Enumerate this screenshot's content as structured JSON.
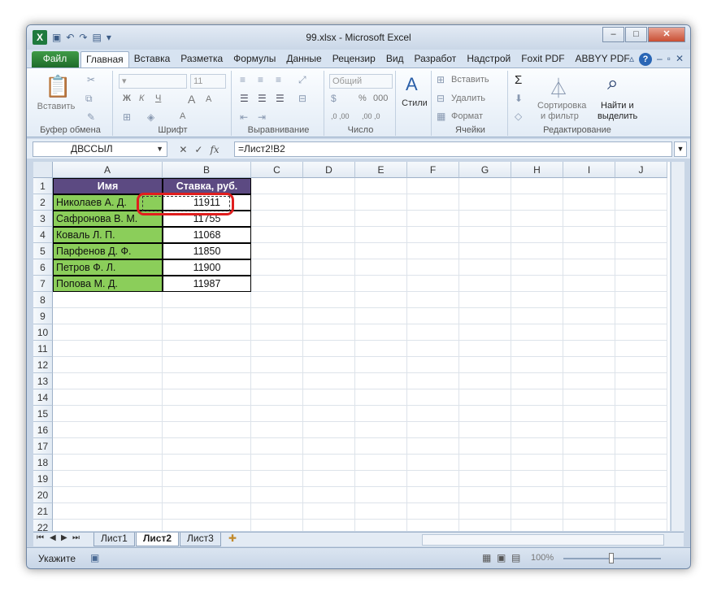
{
  "window": {
    "title": "99.xlsx - Microsoft Excel",
    "app_icon": "X"
  },
  "ribbon_tabs": [
    "Файл",
    "Главная",
    "Вставка",
    "Разметка",
    "Формулы",
    "Данные",
    "Рецензир",
    "Вид",
    "Разработ",
    "Надстрой",
    "Foxit PDF",
    "ABBYY PDF"
  ],
  "ribbon": {
    "clipboard": {
      "paste": "Вставить",
      "label": "Буфер обмена"
    },
    "font": {
      "size": "11",
      "bold": "Ж",
      "italic": "К",
      "underline": "Ч",
      "grow": "А",
      "shrink": "А",
      "label": "Шрифт"
    },
    "alignment": {
      "label": "Выравнивание"
    },
    "number": {
      "format": "Общий",
      "pct": "%",
      "comma": "000",
      "dec_inc": ",0 ,00",
      "dec_dec": ",00 ,0",
      "label": "Число"
    },
    "styles": {
      "label": "Стили"
    },
    "cells": {
      "insert": "Вставить",
      "delete": "Удалить",
      "format": "Формат",
      "label": "Ячейки"
    },
    "editing": {
      "sum": "Σ",
      "sort_line1": "Сортировка",
      "sort_line2": "и фильтр",
      "find_line1": "Найти и",
      "find_line2": "выделить",
      "label": "Редактирование"
    }
  },
  "formula_bar": {
    "name_box": "ДВССЫЛ",
    "cancel": "✕",
    "enter": "✓",
    "fx": "fx",
    "formula": "=Лист2!B2"
  },
  "columns": [
    "A",
    "B",
    "C",
    "D",
    "E",
    "F",
    "G",
    "H",
    "I",
    "J"
  ],
  "rows": [
    "1",
    "2",
    "3",
    "4",
    "5",
    "6",
    "7",
    "8",
    "9",
    "10",
    "11",
    "12",
    "13",
    "14",
    "15",
    "16",
    "17",
    "18",
    "19",
    "20",
    "21",
    "22"
  ],
  "table": {
    "headers": [
      "Имя",
      "Ставка, руб."
    ],
    "rows": [
      {
        "name": "Николаев А. Д.",
        "rate": "11911"
      },
      {
        "name": "Сафронова В. М.",
        "rate": "11755"
      },
      {
        "name": "Коваль Л. П.",
        "rate": "11068"
      },
      {
        "name": "Парфенов Д. Ф.",
        "rate": "11850"
      },
      {
        "name": "Петров Ф. Л.",
        "rate": "11900"
      },
      {
        "name": "Попова М. Д.",
        "rate": "11987"
      }
    ]
  },
  "sheet_tabs": [
    "Лист1",
    "Лист2",
    "Лист3"
  ],
  "active_sheet": "Лист2",
  "status": {
    "mode": "Укажите",
    "zoom": "100%"
  },
  "colors": {
    "header_fill": "#5c4a82",
    "name_fill": "#8bce5a",
    "highlight": "#e01e1e"
  }
}
